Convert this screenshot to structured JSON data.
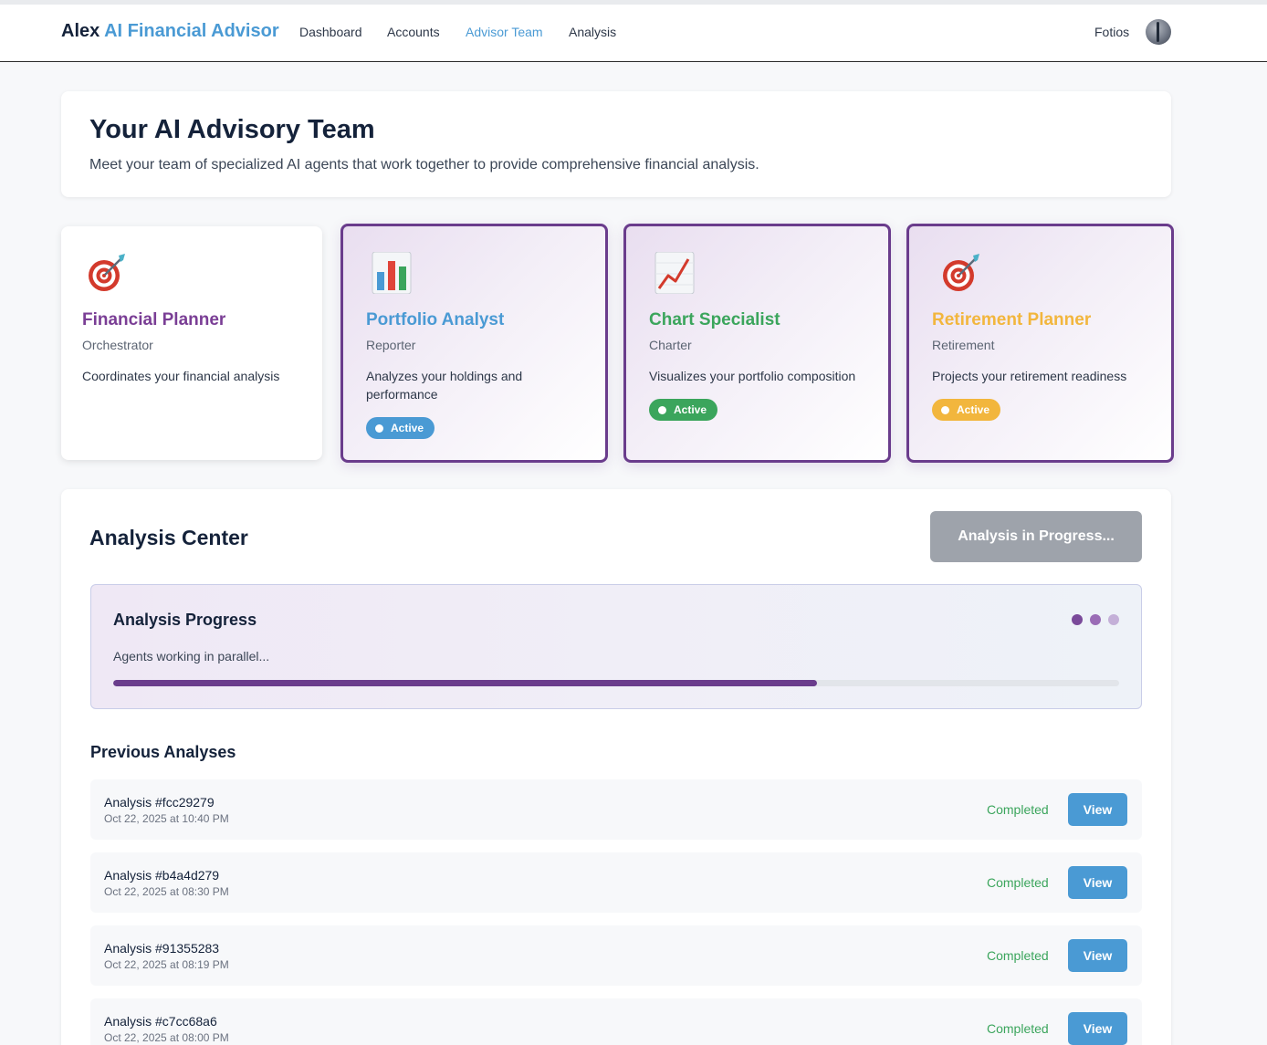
{
  "navbar": {
    "brand_main": "Alex",
    "brand_accent": "AI Financial Advisor",
    "links": [
      "Dashboard",
      "Accounts",
      "Advisor Team",
      "Analysis"
    ],
    "active_link": "Advisor Team",
    "user_name": "Fotios"
  },
  "header": {
    "title": "Your AI Advisory Team",
    "subtitle": "Meet your team of specialized AI agents that work together to provide comprehensive financial analysis."
  },
  "agents": [
    {
      "name": "Financial Planner",
      "role": "Orchestrator",
      "description": "Coordinates your financial analysis",
      "icon": "target-icon",
      "color": "#7a3e95",
      "active": false,
      "badge": ""
    },
    {
      "name": "Portfolio Analyst",
      "role": "Reporter",
      "description": "Analyzes your holdings and performance",
      "icon": "bar-chart-icon",
      "color": "#4a9ad4",
      "active": true,
      "badge": "Active"
    },
    {
      "name": "Chart Specialist",
      "role": "Charter",
      "description": "Visualizes your portfolio composition",
      "icon": "line-chart-icon",
      "color": "#3ba55c",
      "active": true,
      "badge": "Active"
    },
    {
      "name": "Retirement Planner",
      "role": "Retirement",
      "description": "Projects your retirement readiness",
      "icon": "target-icon",
      "color": "#f2b63d",
      "active": true,
      "badge": "Active"
    }
  ],
  "analysis_center": {
    "title": "Analysis Center",
    "button_label": "Analysis in Progress...",
    "progress": {
      "title": "Analysis Progress",
      "status": "Agents working in parallel...",
      "fraction": 0.7,
      "dot_colors": [
        "#7a4a9a",
        "#9a6cb6",
        "#c4b0d8"
      ]
    },
    "previous_title": "Previous Analyses",
    "previous": [
      {
        "id": "Analysis #fcc29279",
        "date": "Oct 22, 2025 at 10:40 PM",
        "status": "Completed",
        "action": "View"
      },
      {
        "id": "Analysis #b4a4d279",
        "date": "Oct 22, 2025 at 08:30 PM",
        "status": "Completed",
        "action": "View"
      },
      {
        "id": "Analysis #91355283",
        "date": "Oct 22, 2025 at 08:19 PM",
        "status": "Completed",
        "action": "View"
      },
      {
        "id": "Analysis #c7cc68a6",
        "date": "Oct 22, 2025 at 08:00 PM",
        "status": "Completed",
        "action": "View"
      }
    ]
  },
  "colors": {
    "accent": "#4a9ad4",
    "purple": "#6a3c8c",
    "success": "#3ba55c",
    "disabled": "#9ea3ab"
  }
}
